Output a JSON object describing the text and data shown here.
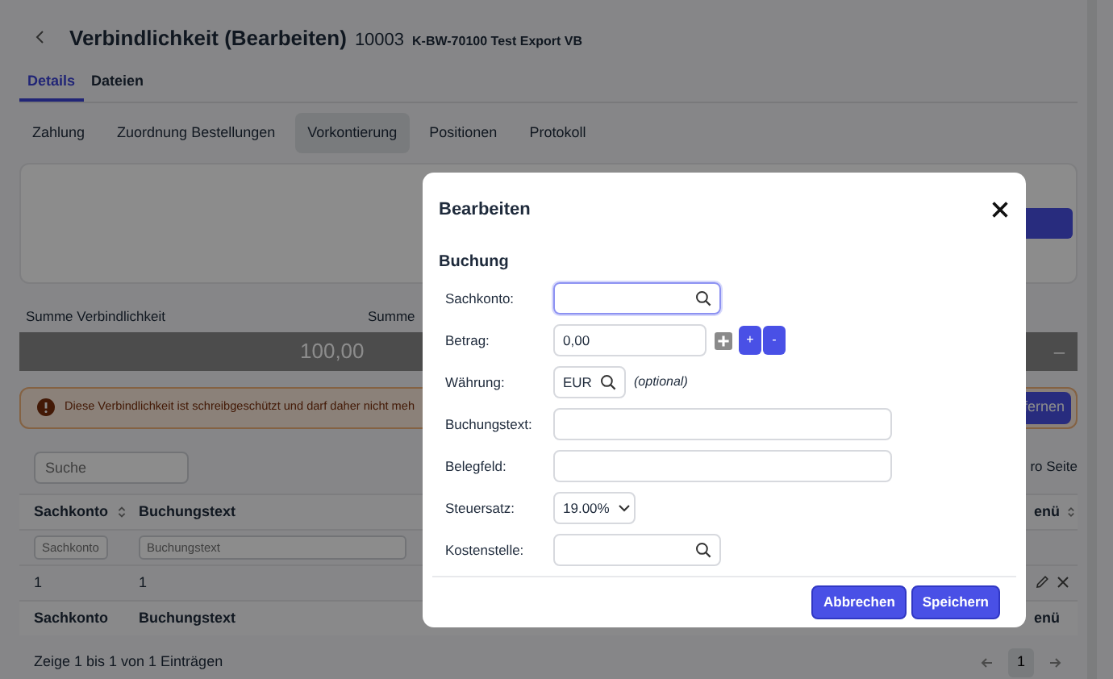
{
  "header": {
    "title": "Verbindlichkeit (Bearbeiten)",
    "number": "10003",
    "subtitle": "K-BW-70100 Test Export VB"
  },
  "tabs": [
    {
      "label": "Details",
      "selected": true
    },
    {
      "label": "Dateien",
      "selected": false
    }
  ],
  "subtabs": [
    {
      "label": "Zahlung",
      "selected": false
    },
    {
      "label": "Zuordnung Bestellungen",
      "selected": false
    },
    {
      "label": "Vorkontierung",
      "selected": true
    },
    {
      "label": "Positionen",
      "selected": false
    },
    {
      "label": "Protokoll",
      "selected": false
    }
  ],
  "summary": {
    "label_1": "Summe Verbindlichkeit",
    "label_2": "Summe",
    "value_1": "100,00",
    "value_2": "–"
  },
  "alert": {
    "text": "Diese Verbindlichkeit ist schreibgeschützt und darf daher nicht meh",
    "button": "fernen"
  },
  "search": {
    "placeholder": "Suche"
  },
  "page_size_label": "ro Seite",
  "table": {
    "columns": [
      {
        "label": "Sachkonto",
        "filter_placeholder": "Sachkonto"
      },
      {
        "label": "Buchungstext",
        "filter_placeholder": "Buchungstext"
      },
      {
        "label": "enü"
      }
    ],
    "rows": [
      {
        "cells": [
          "1",
          "1"
        ]
      }
    ],
    "footer_columns": [
      "Sachkonto",
      "Buchungstext",
      "enü"
    ],
    "info": "Zeige 1 bis 1 von 1 Einträgen",
    "pages": [
      {
        "label": "1",
        "selected": true
      }
    ]
  },
  "modal": {
    "title": "Bearbeiten",
    "section": "Buchung",
    "fields": [
      {
        "kind": "search",
        "label": "Sachkonto:",
        "focused": true
      },
      {
        "kind": "amount",
        "label": "Betrag:",
        "value": "0,00",
        "focused": false,
        "buttons": [
          "+",
          "-"
        ]
      },
      {
        "kind": "currency",
        "label": "Währung:",
        "value": "EUR",
        "hint": "(optional)",
        "focused": false
      },
      {
        "kind": "text",
        "label": "Buchungstext:",
        "focused": false
      },
      {
        "kind": "text",
        "label": "Belegfeld:",
        "focused": false
      },
      {
        "kind": "select",
        "label": "Steuersatz:",
        "value": "19.00%",
        "focused": false
      },
      {
        "kind": "search",
        "label": "Kostenstelle:",
        "focused": false
      }
    ],
    "buttons": [
      "Abbrechen",
      "Speichern"
    ]
  }
}
